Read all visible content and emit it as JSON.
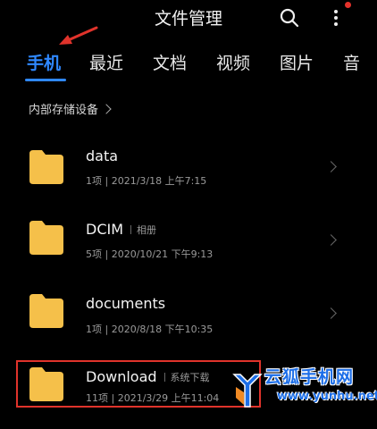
{
  "header": {
    "title": "文件管理"
  },
  "tabs": [
    "手机",
    "最近",
    "文档",
    "视频",
    "图片",
    "音"
  ],
  "breadcrumb": "内部存储设备",
  "folders": [
    {
      "name": "data",
      "tag": "",
      "meta": "1项 | 2021/3/18 上午7:15"
    },
    {
      "name": "DCIM",
      "tag": "相册",
      "meta": "5项 | 2020/10/21 下午9:13"
    },
    {
      "name": "documents",
      "tag": "",
      "meta": "1项 | 2020/8/18 下午10:35"
    },
    {
      "name": "Download",
      "tag": "系统下载",
      "meta": "11项 | 2021/3/29 上午11:04"
    }
  ],
  "watermark": {
    "logo_text": "云狐手机网",
    "url": "www.yunhu.net"
  },
  "colors": {
    "accent": "#2f88ff",
    "folder": "#f5c04a",
    "annotation": "#e0332b"
  }
}
